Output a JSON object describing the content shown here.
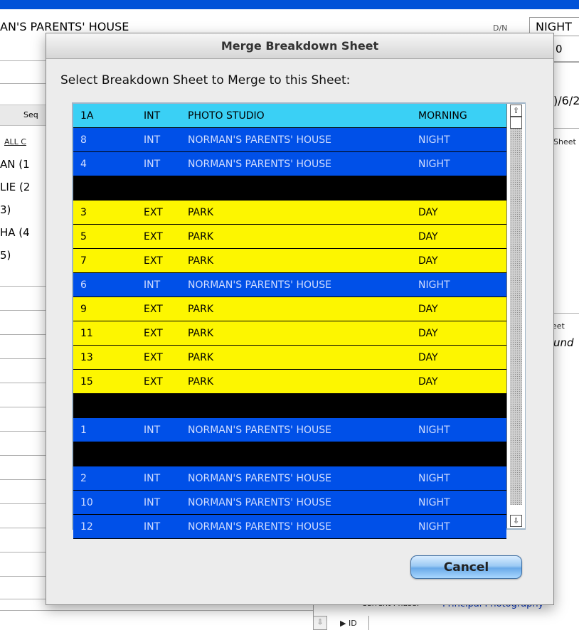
{
  "background": {
    "set_name": "AN'S PARENTS' HOUSE",
    "dn_label": "D/N",
    "dn_value": "NIGHT",
    "date_partial": ")/6/2",
    "seq_label": "Seq",
    "all_c_label": "ALL C",
    "sheet_label": "Sheet",
    "cast": [
      "AN (1",
      "LIE (2",
      "3)",
      "HA (4",
      "5)"
    ],
    "eet_label": "eet",
    "und_text": "und",
    "current_phase_label": "Current Phase:",
    "current_phase_value": "Principal Photography",
    "id_label": "ID",
    "zero": "0"
  },
  "dialog": {
    "title": "Merge Breakdown Sheet",
    "prompt": "Select Breakdown Sheet to Merge to this Sheet:",
    "cancel_label": "Cancel"
  },
  "colors": {
    "selected": "#3ad0f5",
    "blue": "#0050e8",
    "yellow": "#fdf600",
    "black": "#000000",
    "blue_text": "#d0dcff",
    "dark_text": "#000000"
  },
  "rows": [
    {
      "scene": "1A",
      "ie": "INT",
      "set": "PHOTO STUDIO",
      "dn": "MORNING",
      "style": "selected"
    },
    {
      "scene": "8",
      "ie": "INT",
      "set": "NORMAN'S PARENTS' HOUSE",
      "dn": "NIGHT",
      "style": "blue"
    },
    {
      "scene": "4",
      "ie": "INT",
      "set": "NORMAN'S PARENTS' HOUSE",
      "dn": "NIGHT",
      "style": "blue"
    },
    {
      "scene": "",
      "ie": "",
      "set": "",
      "dn": "",
      "style": "black"
    },
    {
      "scene": "3",
      "ie": "EXT",
      "set": "PARK",
      "dn": "DAY",
      "style": "yellow"
    },
    {
      "scene": "5",
      "ie": "EXT",
      "set": "PARK",
      "dn": "DAY",
      "style": "yellow"
    },
    {
      "scene": "7",
      "ie": "EXT",
      "set": "PARK",
      "dn": "DAY",
      "style": "yellow"
    },
    {
      "scene": "6",
      "ie": "INT",
      "set": "NORMAN'S PARENTS' HOUSE",
      "dn": "NIGHT",
      "style": "blue"
    },
    {
      "scene": "9",
      "ie": "EXT",
      "set": "PARK",
      "dn": "DAY",
      "style": "yellow"
    },
    {
      "scene": "11",
      "ie": "EXT",
      "set": "PARK",
      "dn": "DAY",
      "style": "yellow"
    },
    {
      "scene": "13",
      "ie": "EXT",
      "set": "PARK",
      "dn": "DAY",
      "style": "yellow"
    },
    {
      "scene": "15",
      "ie": "EXT",
      "set": "PARK",
      "dn": "DAY",
      "style": "yellow"
    },
    {
      "scene": "",
      "ie": "",
      "set": "",
      "dn": "",
      "style": "black"
    },
    {
      "scene": "1",
      "ie": "INT",
      "set": "NORMAN'S PARENTS' HOUSE",
      "dn": "NIGHT",
      "style": "blue"
    },
    {
      "scene": "",
      "ie": "",
      "set": "",
      "dn": "",
      "style": "black"
    },
    {
      "scene": "2",
      "ie": "INT",
      "set": "NORMAN'S PARENTS' HOUSE",
      "dn": "NIGHT",
      "style": "blue"
    },
    {
      "scene": "10",
      "ie": "INT",
      "set": "NORMAN'S PARENTS' HOUSE",
      "dn": "NIGHT",
      "style": "blue"
    },
    {
      "scene": "12",
      "ie": "INT",
      "set": "NORMAN'S PARENTS' HOUSE",
      "dn": "NIGHT",
      "style": "blue"
    }
  ],
  "icons": {
    "scroll_up": "scroll-up-arrow-icon",
    "scroll_down": "scroll-down-arrow-icon",
    "disclosure": "disclosure-triangle-icon"
  }
}
